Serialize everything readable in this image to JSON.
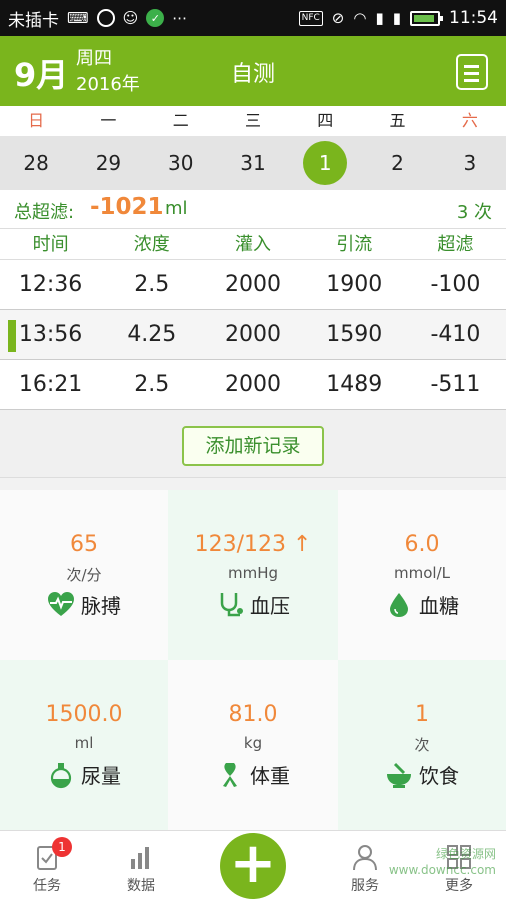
{
  "status_bar": {
    "carrier": "未插卡",
    "nfc": "NFC",
    "time": "11:54"
  },
  "header": {
    "month": "9月",
    "weekday": "周四",
    "year": "2016年",
    "title": "自测"
  },
  "calendar": {
    "weekdays": [
      "日",
      "一",
      "二",
      "三",
      "四",
      "五",
      "六"
    ],
    "dates": [
      "28",
      "29",
      "30",
      "31",
      "1",
      "2",
      "3"
    ],
    "selected_index": 4
  },
  "summary": {
    "label": "总超滤:",
    "value": "-1021",
    "unit": "ml",
    "count": "3 次"
  },
  "table": {
    "headers": [
      "时间",
      "浓度",
      "灌入",
      "引流",
      "超滤"
    ],
    "rows": [
      [
        "12:36",
        "2.5",
        "2000",
        "1900",
        "-100"
      ],
      [
        "13:56",
        "4.25",
        "2000",
        "1590",
        "-410"
      ],
      [
        "16:21",
        "2.5",
        "2000",
        "1489",
        "-511"
      ]
    ]
  },
  "add_button": "添加新记录",
  "metrics": [
    {
      "value": "65",
      "unit": "次/分",
      "name": "脉搏",
      "icon": "heart-pulse-icon"
    },
    {
      "value": "123/123 ↑",
      "unit": "mmHg",
      "name": "血压",
      "icon": "stethoscope-icon"
    },
    {
      "value": "6.0",
      "unit": "mmol/L",
      "name": "血糖",
      "icon": "blood-drop-icon"
    },
    {
      "value": "1500.0",
      "unit": "ml",
      "name": "尿量",
      "icon": "flask-icon"
    },
    {
      "value": "81.0",
      "unit": "kg",
      "name": "体重",
      "icon": "ribbon-icon"
    },
    {
      "value": "1",
      "unit": "次",
      "name": "饮食",
      "icon": "mortar-bowl-icon"
    }
  ],
  "bottom_nav": {
    "tasks": "任务",
    "tasks_badge": "1",
    "data": "数据",
    "services": "服务",
    "more": "更多"
  },
  "watermark": "绿色资源网 www.downcc.com",
  "colors": {
    "brand_green": "#7ab51d",
    "accent_orange": "#f0883a"
  }
}
